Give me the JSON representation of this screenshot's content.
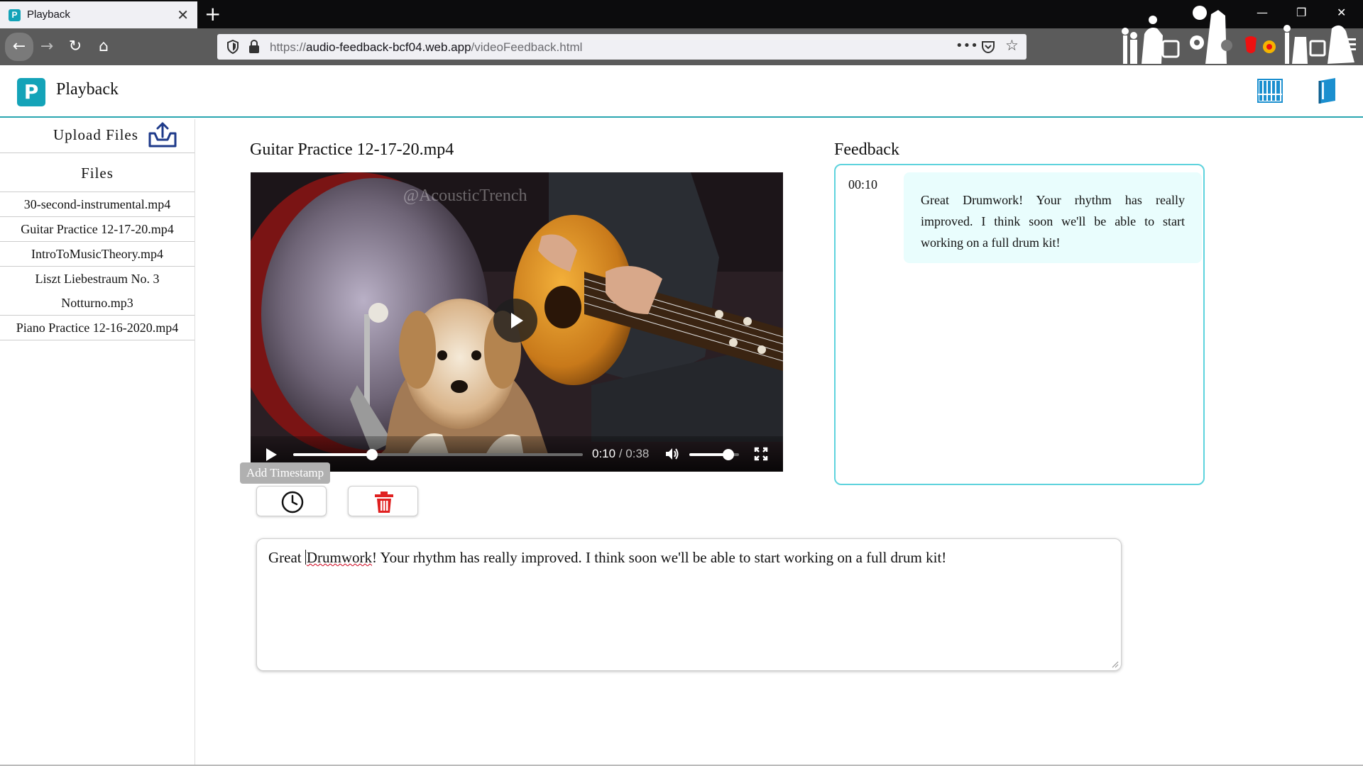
{
  "browser": {
    "tab_title": "Playback",
    "tab_favicon": "P",
    "url_prefix": "https://",
    "url_domain": "audio-feedback-bcf04.web.app",
    "url_path": "/videoFeedback.html",
    "icons": [
      "back-icon",
      "forward-icon",
      "reload-icon",
      "home-icon",
      "shield-icon",
      "lock-icon",
      "more-icon",
      "pocket-icon",
      "bookmark-star-icon",
      "minimize-icon",
      "restore-icon",
      "close-icon",
      "new-tab-icon"
    ]
  },
  "app": {
    "logo_letter": "P",
    "title": "Playback",
    "accent": "#14a3b8",
    "header_icons": [
      "piano-keys-icon",
      "book-icon"
    ]
  },
  "sidebar": {
    "upload_label": "Upload Files",
    "files_heading": "Files",
    "files": [
      "30-second-instrumental.mp4",
      "Guitar Practice 12-17-20.mp4",
      "IntroToMusicTheory.mp4",
      "Liszt Liebestraum No. 3 Notturno.mp3",
      "Piano Practice 12-16-2020.mp4"
    ]
  },
  "player": {
    "title": "Guitar Practice 12-17-20.mp4",
    "watermark": "@AcousticTrench",
    "current_time": "0:10",
    "duration": "/ 0:38",
    "progress_fraction": 0.273,
    "volume_fraction": 0.78
  },
  "actions": {
    "tooltip": "Add Timestamp",
    "icons": [
      "clock-icon",
      "trash-icon"
    ],
    "delete_color": "#e02020"
  },
  "editor": {
    "before": "Great ",
    "misspelled": "Drumwork",
    "after": "! Your rhythm has really improved. I think soon we'll be able to start working on a full drum kit!"
  },
  "feedback": {
    "title": "Feedback",
    "border_color": "#5ed3dd",
    "entries": [
      {
        "time": "00:10",
        "text": "Great Drumwork! Your rhythm has really improved. I think soon we'll be able to start working on a full drum kit!"
      }
    ]
  }
}
